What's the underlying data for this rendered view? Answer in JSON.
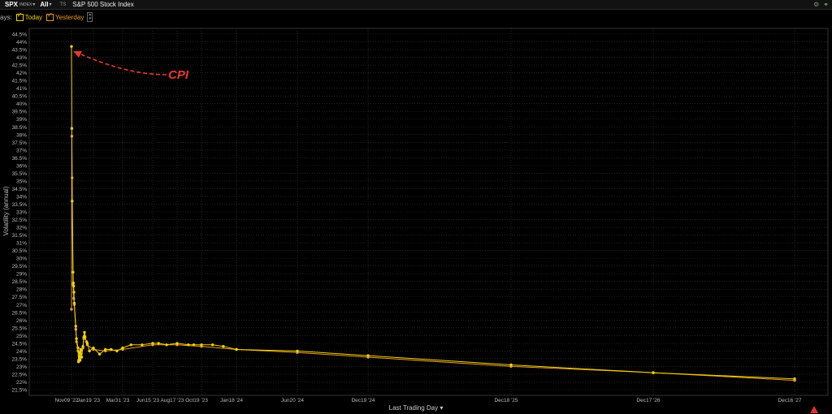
{
  "header": {
    "symbol": "SPX",
    "symbol_exchange": "INDEX",
    "symbol_caret": "▾",
    "range": "All",
    "range_caret": "▾",
    "ts_label": "TS",
    "title": "S&P 500 Stock Index",
    "settings_icon": "gear-icon",
    "link_icon": "link-icon"
  },
  "legend": {
    "prefix": "ays:",
    "today_label": "Today",
    "yesterday_label": "Yesterday",
    "today_color": "#f0d400",
    "yesterday_color": "#e69a2e"
  },
  "annotation": {
    "text": "CPI",
    "color": "#e8392c"
  },
  "footer": {
    "xaxis_label": "Last Trading Day ▾",
    "warning_icon": "warning-icon"
  },
  "chart_data": {
    "type": "line",
    "title": "",
    "xlabel": "Last Trading Day",
    "ylabel": "Volatility (annual)",
    "ylim": [
      21.5,
      44.5
    ],
    "ytick_step": 0.5,
    "y_unit": "%",
    "grid": true,
    "x_tick_labels": [
      {
        "date": "2022-11-09",
        "label": "Nov09 '22"
      },
      {
        "date": "2023-01-19",
        "label": "Jan19 '23"
      },
      {
        "date": "2023-03-31",
        "label": "Mar31 '23"
      },
      {
        "date": "2023-06-15",
        "label": "Jun15 '23"
      },
      {
        "date": "2023-08-17",
        "label": "Aug17 '23"
      },
      {
        "date": "2023-10-19",
        "label": "Oct19 '23"
      },
      {
        "date": "2024-01-18",
        "label": "Jan18 '24"
      },
      {
        "date": "2024-06-20",
        "label": "Jun20 '24"
      },
      {
        "date": "2024-12-19",
        "label": "Dec19 '24"
      },
      {
        "date": "2025-12-18",
        "label": "Dec18 '25"
      },
      {
        "date": "2026-12-17",
        "label": "Dec17 '26"
      },
      {
        "date": "2027-12-16",
        "label": "Dec16 '27"
      }
    ],
    "series": [
      {
        "name": "Today",
        "color": "#f0d400",
        "points": [
          [
            "2022-11-09",
            43.7
          ],
          [
            "2022-11-10",
            38.4
          ],
          [
            "2022-11-11",
            33.7
          ],
          [
            "2022-11-14",
            29.1
          ],
          [
            "2022-11-15",
            28.4
          ],
          [
            "2022-11-16",
            28.2
          ],
          [
            "2022-11-17",
            27.8
          ],
          [
            "2022-11-18",
            27.1
          ],
          [
            "2022-11-23",
            25.6
          ],
          [
            "2022-11-25",
            24.8
          ],
          [
            "2022-11-30",
            24.2
          ],
          [
            "2022-12-02",
            23.3
          ],
          [
            "2022-12-05",
            23.9
          ],
          [
            "2022-12-07",
            23.4
          ],
          [
            "2022-12-09",
            24.1
          ],
          [
            "2022-12-12",
            23.6
          ],
          [
            "2022-12-16",
            24.3
          ],
          [
            "2022-12-19",
            24.9
          ],
          [
            "2022-12-21",
            25.2
          ],
          [
            "2022-12-23",
            24.9
          ],
          [
            "2022-12-28",
            24.6
          ],
          [
            "2022-12-30",
            24.5
          ],
          [
            "2023-01-06",
            24.0
          ],
          [
            "2023-01-19",
            24.2
          ],
          [
            "2023-02-03",
            23.8
          ],
          [
            "2023-02-17",
            24.1
          ],
          [
            "2023-03-03",
            24.1
          ],
          [
            "2023-03-17",
            24.0
          ],
          [
            "2023-03-31",
            24.2
          ],
          [
            "2023-04-21",
            24.4
          ],
          [
            "2023-05-19",
            24.4
          ],
          [
            "2023-06-15",
            24.5
          ],
          [
            "2023-06-30",
            24.5
          ],
          [
            "2023-07-21",
            24.4
          ],
          [
            "2023-08-17",
            24.5
          ],
          [
            "2023-09-15",
            24.4
          ],
          [
            "2023-09-29",
            24.4
          ],
          [
            "2023-10-19",
            24.4
          ],
          [
            "2023-11-17",
            24.4
          ],
          [
            "2023-12-15",
            24.3
          ],
          [
            "2024-01-18",
            24.1
          ],
          [
            "2024-06-20",
            24.0
          ],
          [
            "2024-12-19",
            23.7
          ],
          [
            "2025-12-18",
            23.1
          ],
          [
            "2026-12-17",
            22.6
          ],
          [
            "2027-12-16",
            22.2
          ]
        ]
      },
      {
        "name": "Yesterday",
        "color": "#e69a2e",
        "points": [
          [
            "2022-11-09",
            26.7
          ],
          [
            "2022-11-10",
            37.9
          ],
          [
            "2022-11-11",
            35.2
          ],
          [
            "2022-11-14",
            28.3
          ],
          [
            "2022-11-16",
            27.4
          ],
          [
            "2022-11-18",
            27.0
          ],
          [
            "2022-11-23",
            25.4
          ],
          [
            "2022-11-25",
            24.6
          ],
          [
            "2022-11-30",
            24.0
          ],
          [
            "2022-12-02",
            23.4
          ],
          [
            "2022-12-07",
            23.5
          ],
          [
            "2022-12-09",
            24.0
          ],
          [
            "2022-12-16",
            24.2
          ],
          [
            "2022-12-19",
            24.8
          ],
          [
            "2022-12-21",
            25.0
          ],
          [
            "2022-12-30",
            24.4
          ],
          [
            "2023-01-19",
            24.1
          ],
          [
            "2023-02-17",
            24.0
          ],
          [
            "2023-03-31",
            24.1
          ],
          [
            "2023-06-15",
            24.4
          ],
          [
            "2023-08-17",
            24.4
          ],
          [
            "2023-10-19",
            24.3
          ],
          [
            "2024-01-18",
            24.1
          ],
          [
            "2024-06-20",
            23.9
          ],
          [
            "2024-12-19",
            23.6
          ],
          [
            "2025-12-18",
            23.0
          ],
          [
            "2026-12-17",
            22.6
          ],
          [
            "2027-12-16",
            22.1
          ]
        ]
      }
    ]
  }
}
